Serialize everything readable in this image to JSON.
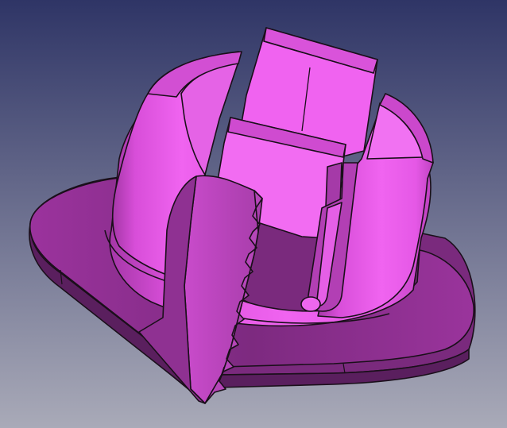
{
  "viewport": {
    "background_top": "#2f3566",
    "background_bottom": "#a9aab8"
  },
  "model": {
    "name": "",
    "colors": {
      "face_light": "#f062f0",
      "face_mid": "#cf45d0",
      "face_dark": "#8c2d8e",
      "face_shadow": "#6a2370",
      "edge": "#1a0f1a"
    }
  }
}
